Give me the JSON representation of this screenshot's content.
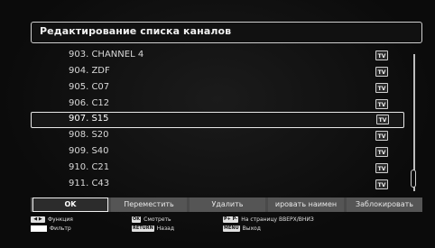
{
  "header": {
    "title": "Редактирование списка каналов"
  },
  "channels": [
    {
      "label": "903. CHANNEL 4",
      "badge": "TV",
      "selected": false
    },
    {
      "label": "904. ZDF",
      "badge": "TV",
      "selected": false
    },
    {
      "label": "905. C07",
      "badge": "TV",
      "selected": false
    },
    {
      "label": "906. C12",
      "badge": "TV",
      "selected": false
    },
    {
      "label": "907. S15",
      "badge": "TV",
      "selected": true
    },
    {
      "label": "908. S20",
      "badge": "TV",
      "selected": false
    },
    {
      "label": "909. S40",
      "badge": "TV",
      "selected": false
    },
    {
      "label": "910. C21",
      "badge": "TV",
      "selected": false
    },
    {
      "label": "911. C43",
      "badge": "TV",
      "selected": false
    }
  ],
  "buttons": {
    "ok": "OK",
    "move": "Переместить",
    "delete": "Удалить",
    "rename": "ировать наимен",
    "lock": "Заблокировать"
  },
  "legend": {
    "function_label": "Функция",
    "filter_label": "Фильтр",
    "ok_key": "OK",
    "watch_label": "Смотреть",
    "return_key": "RETURN",
    "back_label": "Назад",
    "page_key": "P+ P-",
    "page_label": "На страницу ВВЕРХ/ВНИЗ",
    "menu_key": "MENU",
    "exit_label": "Выход"
  },
  "colors": {
    "background": "#0a0a0a",
    "button_bar": "#4a4a4a",
    "filter_swatch": "#ffffff"
  },
  "scroll": {
    "position_fraction": 0.9
  }
}
